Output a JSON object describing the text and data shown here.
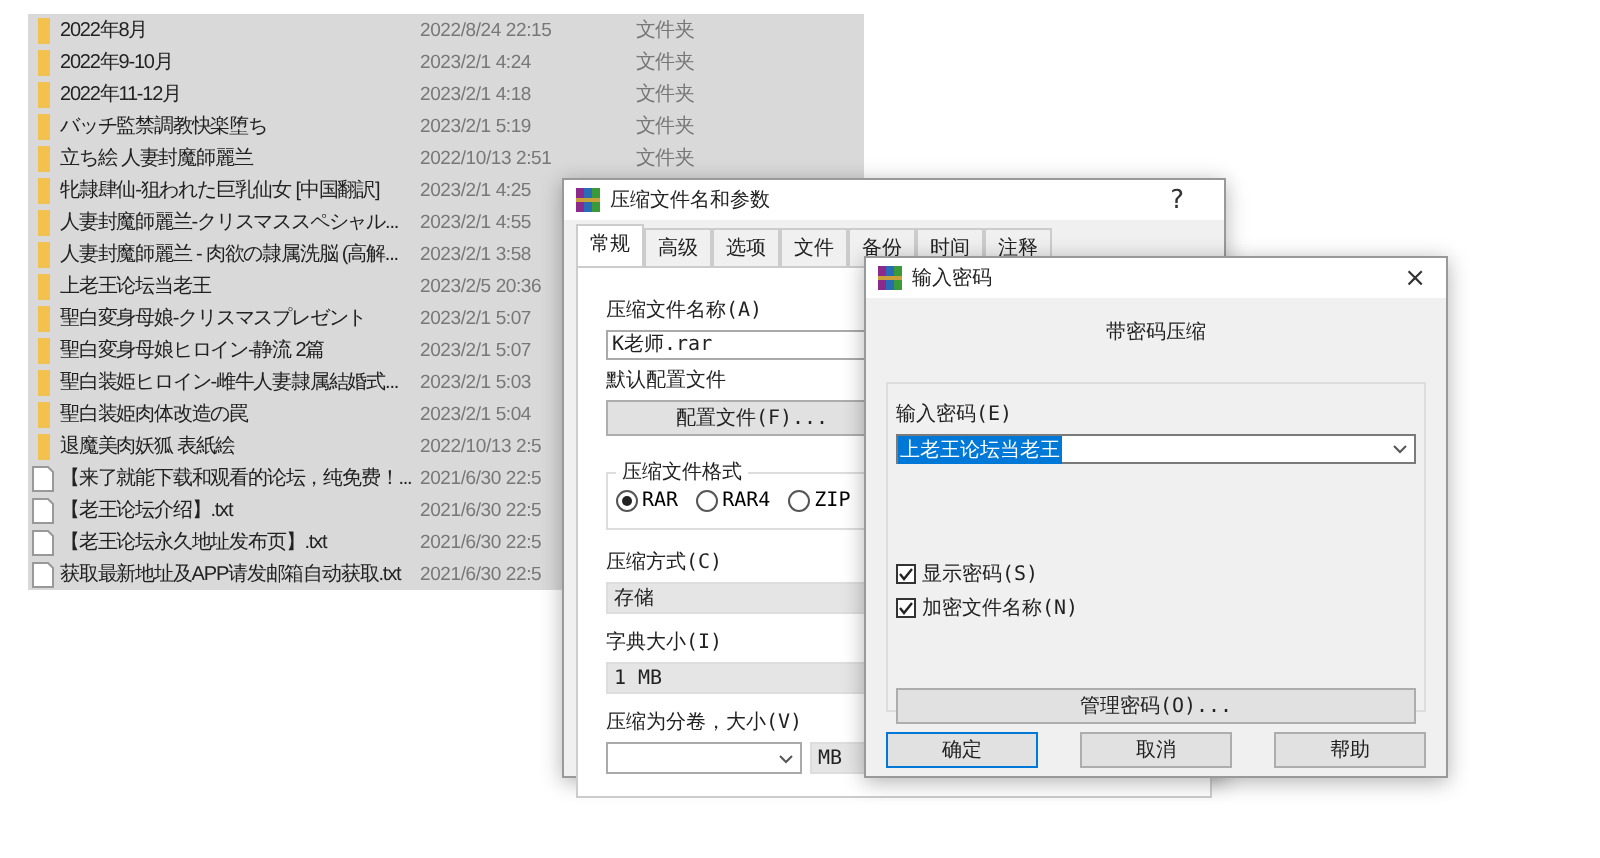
{
  "file_list": {
    "rows": [
      {
        "kind": "folder",
        "name": "2022年8月",
        "date": "2022/8/24 22:15",
        "type": "文件夹"
      },
      {
        "kind": "folder",
        "name": "2022年9-10月",
        "date": "2023/2/1 4:24",
        "type": "文件夹"
      },
      {
        "kind": "folder",
        "name": "2022年11-12月",
        "date": "2023/2/1 4:18",
        "type": "文件夹"
      },
      {
        "kind": "folder",
        "name": "バッチ監禁調教快楽堕ち",
        "date": "2023/2/1 5:19",
        "type": "文件夹"
      },
      {
        "kind": "folder",
        "name": "立ち絵 人妻封魔師麗兰",
        "date": "2022/10/13 2:51",
        "type": "文件夹"
      },
      {
        "kind": "folder",
        "name": "牝隷肆仙-狙われた巨乳仙女 [中国翻訳]",
        "date": "2023/2/1 4:25"
      },
      {
        "kind": "folder",
        "name": "人妻封魔師麗兰-クリスマススペシャル...",
        "date": "2023/2/1 4:55"
      },
      {
        "kind": "folder",
        "name": "人妻封魔師麗兰 - 肉欲の隷属洗脳 (高解...",
        "date": "2023/2/1 3:58"
      },
      {
        "kind": "folder",
        "name": "上老王论坛当老王",
        "date": "2023/2/5 20:36"
      },
      {
        "kind": "folder",
        "name": "聖白変身母娘-クリスマスプレゼント",
        "date": "2023/2/1 5:07"
      },
      {
        "kind": "folder",
        "name": "聖白変身母娘ヒロイン-静流 2篇",
        "date": "2023/2/1 5:07"
      },
      {
        "kind": "folder",
        "name": "聖白装姫ヒロイン-雌牛人妻隷属結婚式...",
        "date": "2023/2/1 5:03"
      },
      {
        "kind": "folder",
        "name": "聖白装姫肉体改造の罠",
        "date": "2023/2/1 5:04"
      },
      {
        "kind": "folder",
        "name": "退魔美肉妖狐 表紙絵",
        "date": "2022/10/13 2:5"
      },
      {
        "kind": "file",
        "name": "【来了就能下载和观看的论坛，纯免费！...",
        "date": "2021/6/30 22:5"
      },
      {
        "kind": "file",
        "name": "【老王论坛介绍】.txt",
        "date": "2021/6/30 22:5"
      },
      {
        "kind": "file",
        "name": "【老王论坛永久地址发布页】.txt",
        "date": "2021/6/30 22:5"
      },
      {
        "kind": "file",
        "name": "获取最新地址及APP请发邮箱自动获取.txt",
        "date": "2021/6/30 22:5"
      }
    ]
  },
  "compress_dialog": {
    "title": "压缩文件名和参数",
    "help": "?",
    "tabs": [
      {
        "label": "常规",
        "selected": true
      },
      {
        "label": "高级",
        "selected": false
      },
      {
        "label": "选项",
        "selected": false
      },
      {
        "label": "文件",
        "selected": false
      },
      {
        "label": "备份",
        "selected": false
      },
      {
        "label": "时间",
        "selected": false
      },
      {
        "label": "注释",
        "selected": false
      }
    ],
    "archive_name_label": "压缩文件名称(A)",
    "archive_name": "K老师.rar",
    "profile_label": "默认配置文件",
    "profile_button": "配置文件(F)...",
    "format_group": {
      "title": "压缩文件格式",
      "options": [
        {
          "label": "RAR",
          "selected": true
        },
        {
          "label": "RAR4",
          "selected": false
        },
        {
          "label": "ZIP",
          "selected": false
        }
      ]
    },
    "method_label": "压缩方式(C)",
    "method": "存储",
    "dictionary_label": "字典大小(I)",
    "dictionary": "1 MB",
    "volume_label": "压缩为分卷，大小(V)",
    "volume_unit": "MB"
  },
  "password_dialog": {
    "title": "输入密码",
    "close": "×",
    "heading": "带密码压缩",
    "password_label": "输入密码(E)",
    "password": {
      "value": "上老王论坛当老王",
      "selected": true
    },
    "checkboxes": [
      {
        "label": "显示密码(S)",
        "checked": true
      },
      {
        "label": "加密文件名称(N)",
        "checked": true
      }
    ],
    "manage_button": "管理密码(O)...",
    "buttons": [
      {
        "label": "确定",
        "default": true
      },
      {
        "label": "取消",
        "default": false
      },
      {
        "label": "帮助",
        "default": false
      }
    ]
  }
}
